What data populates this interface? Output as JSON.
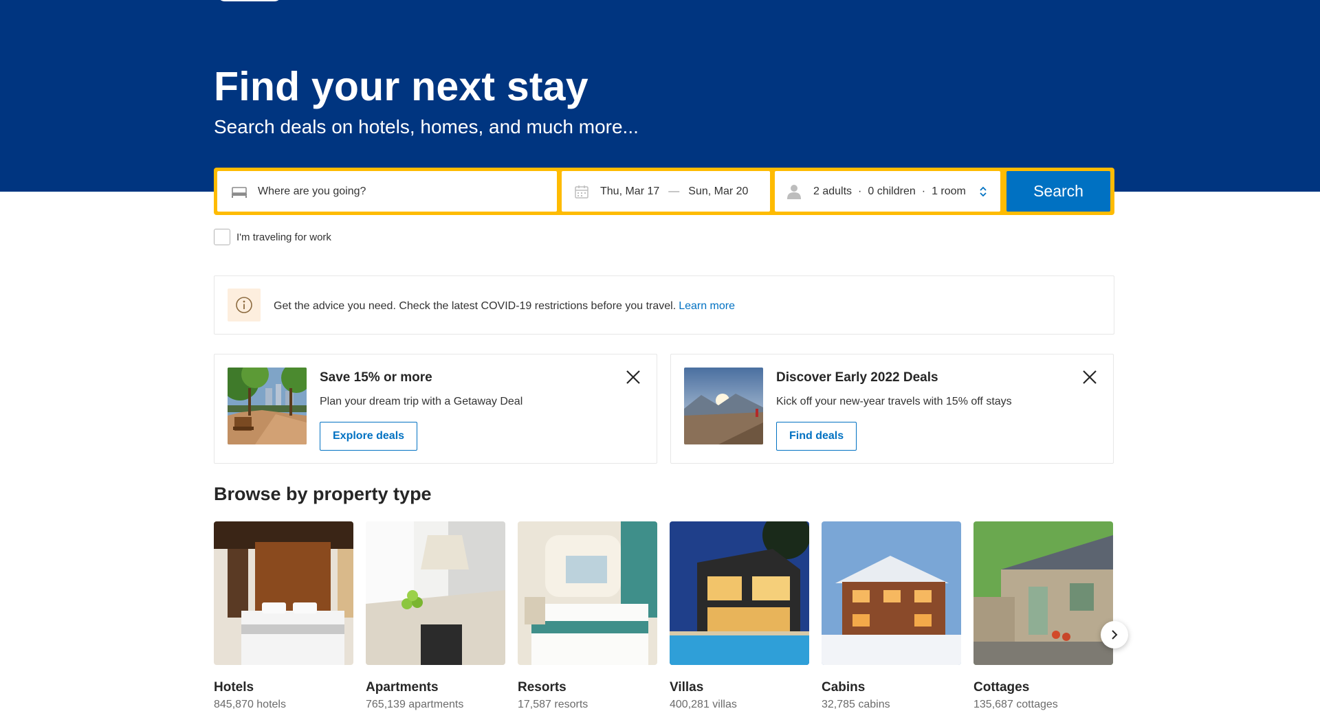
{
  "hero": {
    "title": "Find your next stay",
    "subtitle": "Search deals on hotels, homes, and much more..."
  },
  "search": {
    "destination_placeholder": "Where are you going?",
    "checkin": "Thu, Mar 17",
    "date_separator": "—",
    "checkout": "Sun, Mar 20",
    "adults": "2 adults",
    "children": "0 children",
    "rooms": "1 room",
    "dot": "·",
    "button_label": "Search",
    "icons": {
      "destination": "bed-icon",
      "dates": "calendar-icon",
      "guests": "person-icon",
      "stepper": "up-down-arrows-icon"
    }
  },
  "work_checkbox": {
    "label": "I'm traveling for work",
    "checked": false
  },
  "advice": {
    "text": "Get the advice you need. Check the latest COVID-19 restrictions before you travel.",
    "link": "Learn more",
    "icon": "info-icon"
  },
  "promos": [
    {
      "title": "Save 15% or more",
      "description": "Plan your dream trip with a Getaway Deal",
      "button": "Explore deals",
      "image": "park-promenade-photo"
    },
    {
      "title": "Discover Early 2022 Deals",
      "description": "Kick off your new-year travels with 15% off stays",
      "button": "Find deals",
      "image": "mountain-valley-photo"
    }
  ],
  "browse": {
    "title": "Browse by property type",
    "items": [
      {
        "name": "Hotels",
        "count": "845,870 hotels"
      },
      {
        "name": "Apartments",
        "count": "765,139 apartments"
      },
      {
        "name": "Resorts",
        "count": "17,587 resorts"
      },
      {
        "name": "Villas",
        "count": "400,281 villas"
      },
      {
        "name": "Cabins",
        "count": "32,785 cabins"
      },
      {
        "name": "Cottages",
        "count": "135,687 cottages"
      }
    ]
  },
  "colors": {
    "brand": "#003580",
    "accent_yellow": "#febb02",
    "action_blue": "#0071c2"
  }
}
